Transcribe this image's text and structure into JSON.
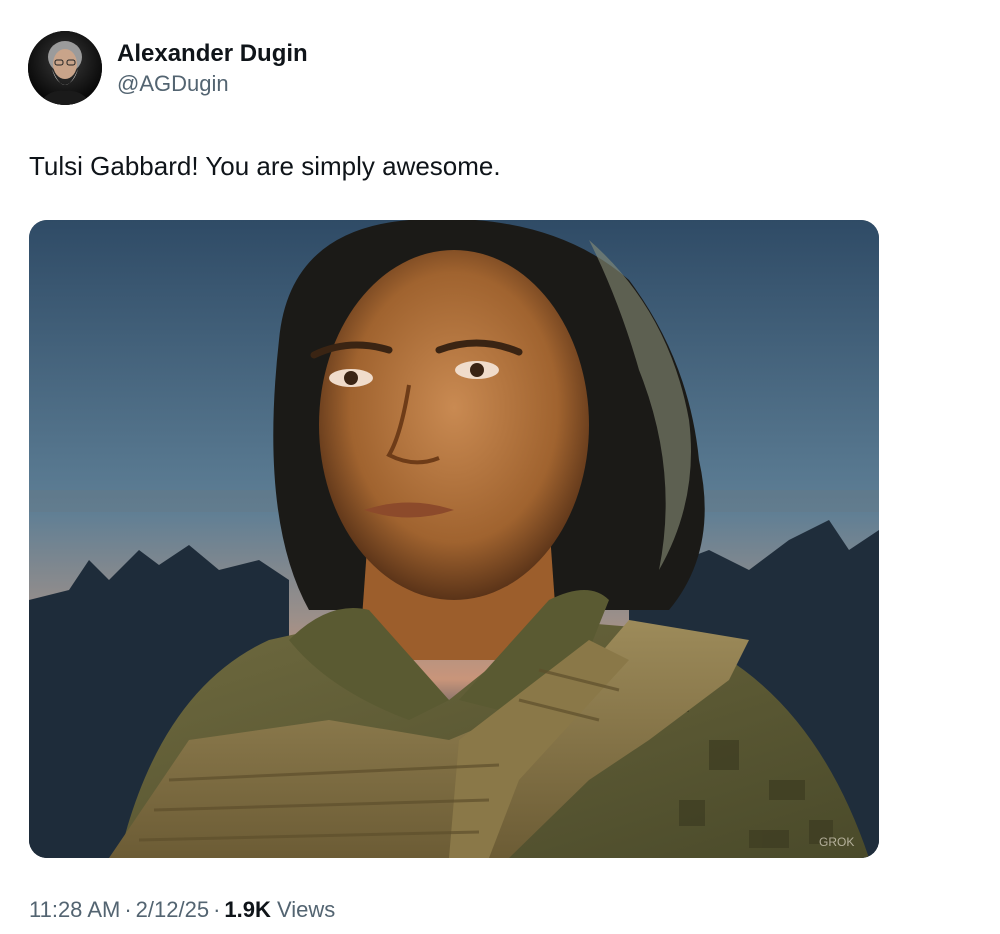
{
  "author": {
    "display_name": "Alexander Dugin",
    "handle": "@AGDugin"
  },
  "tweet": {
    "text": "Tulsi Gabbard! You are simply awesome."
  },
  "media": {
    "watermark": "GROK"
  },
  "meta": {
    "time": "11:28 AM",
    "date": "2/12/25",
    "separator": "·",
    "views_count": "1.9K",
    "views_label": "Views"
  },
  "colors": {
    "text_primary": "#0f1419",
    "text_secondary": "#536471",
    "background": "#ffffff"
  }
}
